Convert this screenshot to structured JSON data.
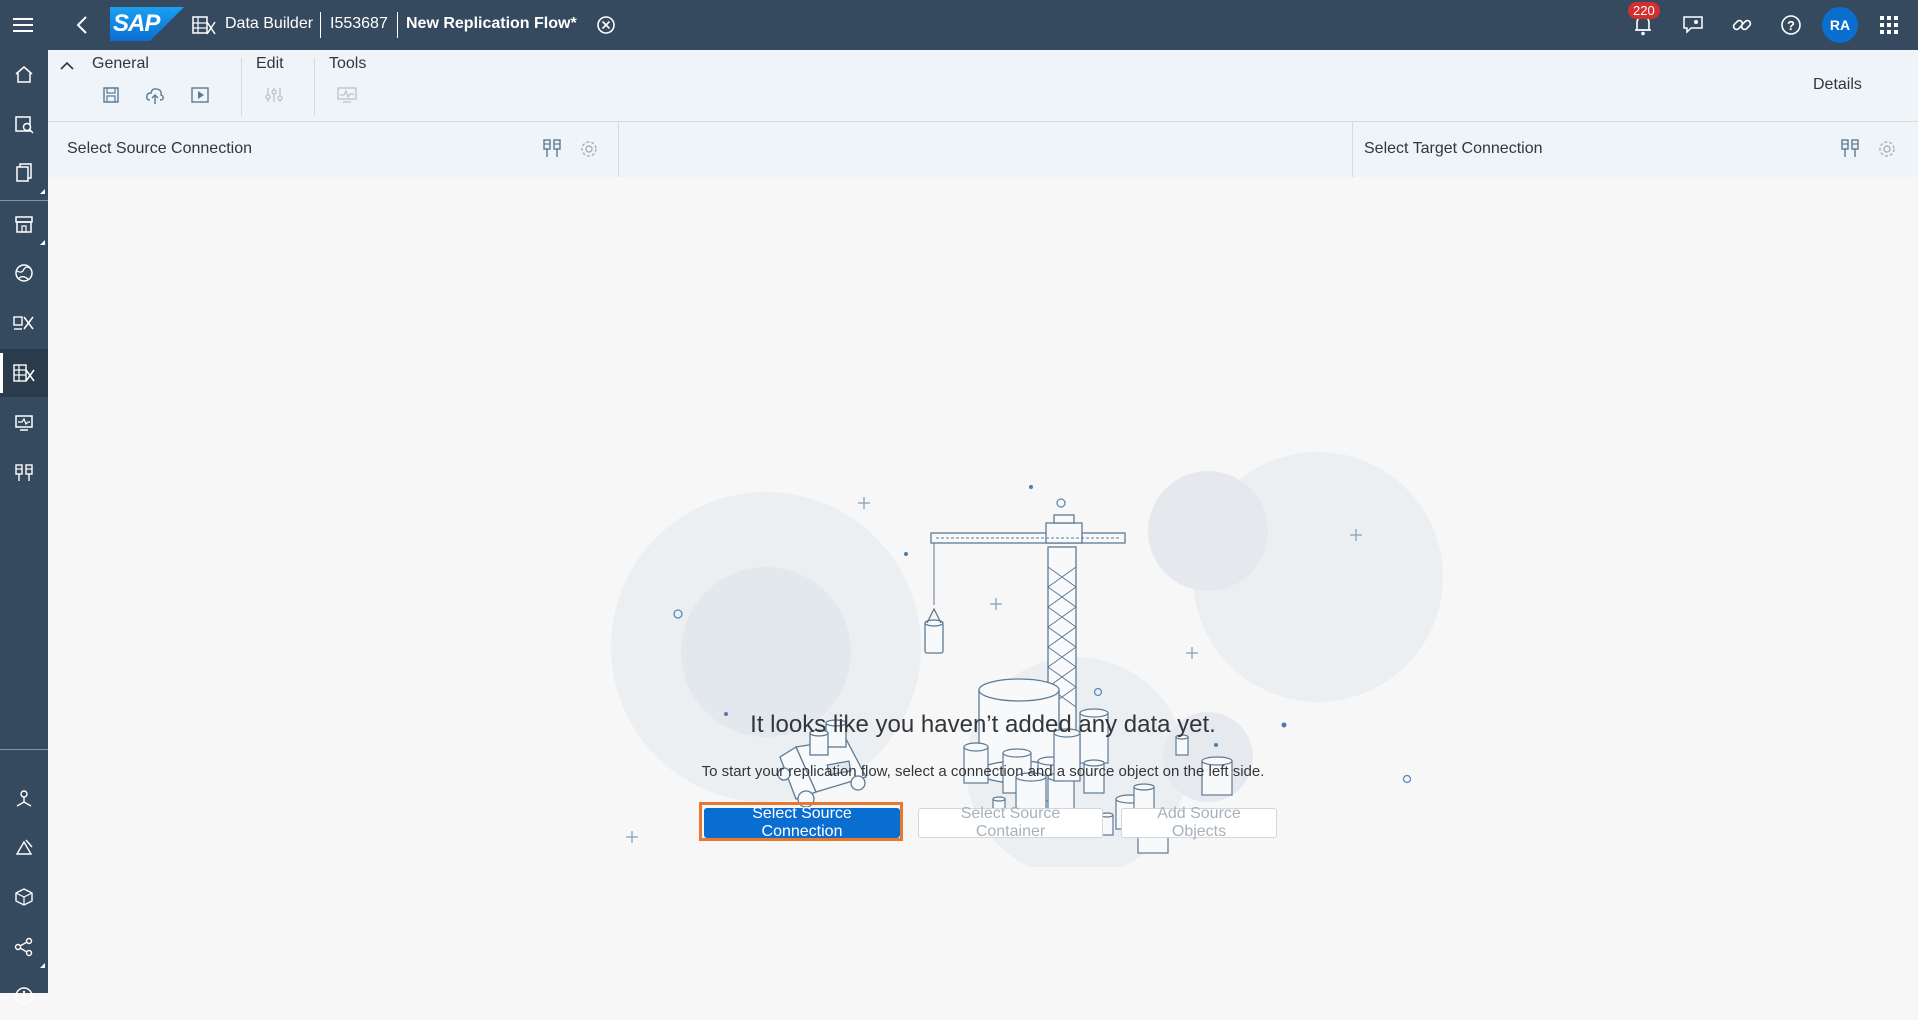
{
  "shell": {
    "logo_text": "SAP",
    "app_name": "Data Builder",
    "space_id": "I553687",
    "document_title": "New Replication Flow*",
    "notification_count": "220",
    "avatar_initials": "RA"
  },
  "toolbar": {
    "general_label": "General",
    "edit_label": "Edit",
    "tools_label": "Tools",
    "details_label": "Details"
  },
  "source_panel": {
    "title": "Select Source Connection"
  },
  "target_panel": {
    "title": "Select Target Connection"
  },
  "empty_state": {
    "title": "It looks like you haven’t added any data yet.",
    "subtitle": "To start your replication flow, select a connection and a source object on the left side.",
    "primary_button": "Select Source Connection",
    "container_button": "Select Source Container",
    "objects_button": "Add Source Objects"
  },
  "colors": {
    "shell": "#354a5f",
    "accent": "#0a6ed1",
    "focus": "#e9772d",
    "badge": "#d32f2f"
  }
}
